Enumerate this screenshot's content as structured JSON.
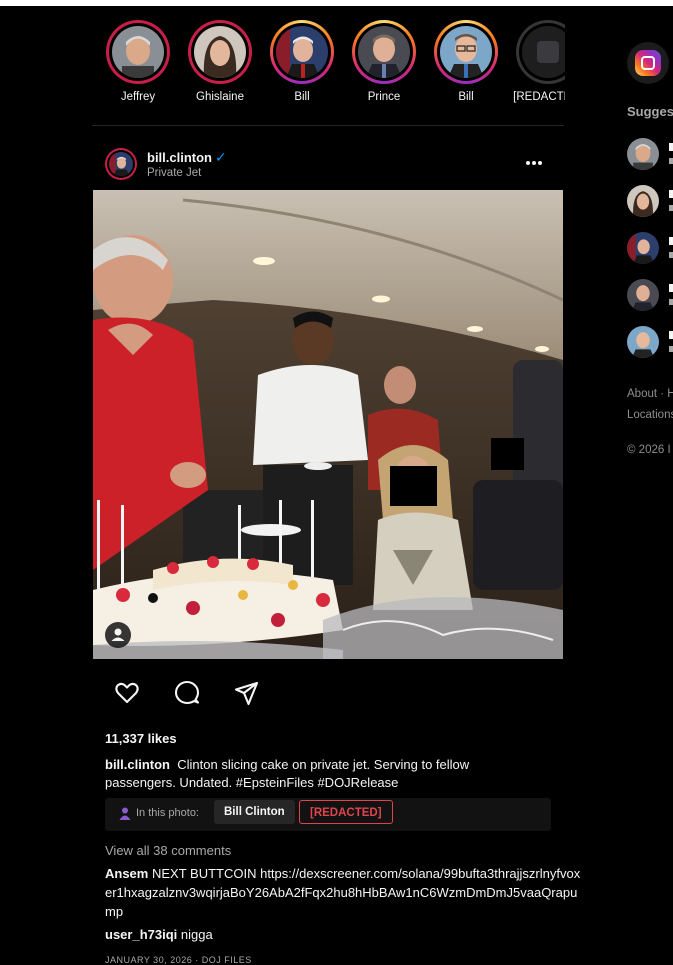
{
  "stories": [
    {
      "name": "Jeffrey",
      "ring": "red"
    },
    {
      "name": "Ghislaine",
      "ring": "red"
    },
    {
      "name": "Bill",
      "ring": "gradient"
    },
    {
      "name": "Prince",
      "ring": "gradient"
    },
    {
      "name": "Bill",
      "ring": "gradient"
    },
    {
      "name": "[REDACTED]",
      "ring": "plain"
    }
  ],
  "post": {
    "username": "bill.clinton",
    "verified_icon": "✓",
    "location": "Private Jet",
    "likes": "11,337 likes",
    "caption_user": "bill.clinton",
    "caption_text": "Clinton slicing cake on private jet. Serving to fellow passengers. Undated. #EpsteinFiles #DOJRelease",
    "in_photo_label": "In this photo:",
    "tags": [
      "Bill Clinton",
      "[REDACTED]"
    ],
    "view_all": "View all 38 comments",
    "comments": [
      {
        "user": "Ansem",
        "text": "NEXT BUTTCOIN https://dexscreener.com/solana/99bufta3thrajjszrlnyfvoxer1hxagzalznv3wqirjaBoY26AbA2fFqx2hu8hHbBAw1nC6WzmDmDmJ5vaaQrapump"
      },
      {
        "user": "user_h73iqi",
        "text": "nigga"
      }
    ],
    "date": "JANUARY 30, 2026 · DOJ FILES"
  },
  "sidebar": {
    "suggest_title": "Sugges",
    "about": "About · H",
    "locations": "Locations",
    "copyright": "© 2026 I"
  },
  "colors": {
    "accent_blue": "#0095f6",
    "redacted_red": "#e0454d",
    "story_ring_red": "#c81e4a"
  }
}
